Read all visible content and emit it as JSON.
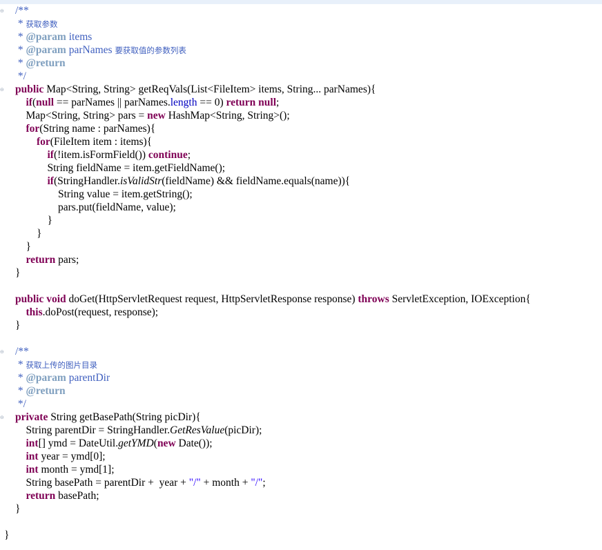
{
  "editor": {
    "language": "java",
    "lines": [
      [
        {
          "c": "cm",
          "t": "/**"
        }
      ],
      [
        {
          "c": "cm",
          "t": " * "
        },
        {
          "c": "cm-cn",
          "t": "获取参数"
        }
      ],
      [
        {
          "c": "cm",
          "t": " * "
        },
        {
          "c": "cm-tag",
          "t": "@param"
        },
        {
          "c": "cm",
          "t": " items"
        }
      ],
      [
        {
          "c": "cm",
          "t": " * "
        },
        {
          "c": "cm-tag",
          "t": "@param"
        },
        {
          "c": "cm",
          "t": " parNames "
        },
        {
          "c": "cm-cn",
          "t": "要获取值的参数列表"
        }
      ],
      [
        {
          "c": "cm",
          "t": " * "
        },
        {
          "c": "cm-tag",
          "t": "@return"
        }
      ],
      [
        {
          "c": "cm",
          "t": " */"
        }
      ],
      [
        {
          "c": "kw",
          "t": "public"
        },
        {
          "c": "",
          "t": " Map<String, String> getReqVals(List<FileItem> items, String... parNames){"
        }
      ],
      [
        {
          "c": "",
          "t": "    "
        },
        {
          "c": "kw",
          "t": "if"
        },
        {
          "c": "",
          "t": "("
        },
        {
          "c": "kw",
          "t": "null"
        },
        {
          "c": "",
          "t": " == parNames || parNames."
        },
        {
          "c": "field",
          "t": "length"
        },
        {
          "c": "",
          "t": " == 0) "
        },
        {
          "c": "kw",
          "t": "return"
        },
        {
          "c": "",
          "t": " "
        },
        {
          "c": "kw",
          "t": "null"
        },
        {
          "c": "",
          "t": ";"
        }
      ],
      [
        {
          "c": "",
          "t": "    Map<String, String> pars = "
        },
        {
          "c": "kw",
          "t": "new"
        },
        {
          "c": "",
          "t": " HashMap<String, String>();"
        }
      ],
      [
        {
          "c": "",
          "t": "    "
        },
        {
          "c": "kw",
          "t": "for"
        },
        {
          "c": "",
          "t": "(String name : parNames){"
        }
      ],
      [
        {
          "c": "",
          "t": "        "
        },
        {
          "c": "kw",
          "t": "for"
        },
        {
          "c": "",
          "t": "(FileItem item : items){"
        }
      ],
      [
        {
          "c": "",
          "t": "            "
        },
        {
          "c": "kw",
          "t": "if"
        },
        {
          "c": "",
          "t": "(!item.isFormField()) "
        },
        {
          "c": "kw",
          "t": "continue"
        },
        {
          "c": "",
          "t": ";"
        }
      ],
      [
        {
          "c": "",
          "t": "            String fieldName = item.getFieldName();"
        }
      ],
      [
        {
          "c": "",
          "t": "            "
        },
        {
          "c": "kw",
          "t": "if"
        },
        {
          "c": "",
          "t": "(StringHandler."
        },
        {
          "c": "ital",
          "t": "isValidStr"
        },
        {
          "c": "",
          "t": "(fieldName) && fieldName.equals(name)){"
        }
      ],
      [
        {
          "c": "",
          "t": "                String value = item.getString();"
        }
      ],
      [
        {
          "c": "",
          "t": "                pars.put(fieldName, value);"
        }
      ],
      [
        {
          "c": "",
          "t": "            }"
        }
      ],
      [
        {
          "c": "",
          "t": "        }"
        }
      ],
      [
        {
          "c": "",
          "t": "    }"
        }
      ],
      [
        {
          "c": "",
          "t": "    "
        },
        {
          "c": "kw",
          "t": "return"
        },
        {
          "c": "",
          "t": " pars;"
        }
      ],
      [
        {
          "c": "",
          "t": "}"
        }
      ],
      [],
      [
        {
          "c": "kw",
          "t": "public"
        },
        {
          "c": "",
          "t": " "
        },
        {
          "c": "kw",
          "t": "void"
        },
        {
          "c": "",
          "t": " doGet(HttpServletRequest request, HttpServletResponse response) "
        },
        {
          "c": "kw",
          "t": "throws"
        },
        {
          "c": "",
          "t": " ServletException, IOException{"
        }
      ],
      [
        {
          "c": "",
          "t": "    "
        },
        {
          "c": "kw",
          "t": "this"
        },
        {
          "c": "",
          "t": ".doPost(request, response);"
        }
      ],
      [
        {
          "c": "",
          "t": "}"
        }
      ],
      [],
      [
        {
          "c": "cm",
          "t": "/**"
        }
      ],
      [
        {
          "c": "cm",
          "t": " * "
        },
        {
          "c": "cm-cn",
          "t": "获取上传的图片目录"
        }
      ],
      [
        {
          "c": "cm",
          "t": " * "
        },
        {
          "c": "cm-tag",
          "t": "@param"
        },
        {
          "c": "cm",
          "t": " parentDir"
        }
      ],
      [
        {
          "c": "cm",
          "t": " * "
        },
        {
          "c": "cm-tag",
          "t": "@return"
        }
      ],
      [
        {
          "c": "cm",
          "t": " */"
        }
      ],
      [
        {
          "c": "kw",
          "t": "private"
        },
        {
          "c": "",
          "t": " String getBasePath(String picDir){"
        }
      ],
      [
        {
          "c": "",
          "t": "    String parentDir = StringHandler."
        },
        {
          "c": "ital",
          "t": "GetResValue"
        },
        {
          "c": "",
          "t": "(picDir);"
        }
      ],
      [
        {
          "c": "",
          "t": "    "
        },
        {
          "c": "kw",
          "t": "int"
        },
        {
          "c": "",
          "t": "[] ymd = DateUtil."
        },
        {
          "c": "ital",
          "t": "getYMD"
        },
        {
          "c": "",
          "t": "("
        },
        {
          "c": "kw",
          "t": "new"
        },
        {
          "c": "",
          "t": " Date());"
        }
      ],
      [
        {
          "c": "",
          "t": "    "
        },
        {
          "c": "kw",
          "t": "int"
        },
        {
          "c": "",
          "t": " year = ymd[0];"
        }
      ],
      [
        {
          "c": "",
          "t": "    "
        },
        {
          "c": "kw",
          "t": "int"
        },
        {
          "c": "",
          "t": " month = ymd[1];"
        }
      ],
      [
        {
          "c": "",
          "t": "    String basePath = parentDir +  year + "
        },
        {
          "c": "str",
          "t": "\"/\""
        },
        {
          "c": "",
          "t": " + month + "
        },
        {
          "c": "str",
          "t": "\"/\""
        },
        {
          "c": "",
          "t": ";"
        }
      ],
      [
        {
          "c": "",
          "t": "    "
        },
        {
          "c": "kw",
          "t": "return"
        },
        {
          "c": "",
          "t": " basePath;"
        }
      ],
      [
        {
          "c": "",
          "t": "}"
        }
      ],
      [],
      [
        {
          "c": "",
          "t": "}"
        }
      ]
    ]
  },
  "gutter": {
    "fold_marker_icon": "fold-collapse-icon",
    "fold_glyph": "⊖"
  }
}
